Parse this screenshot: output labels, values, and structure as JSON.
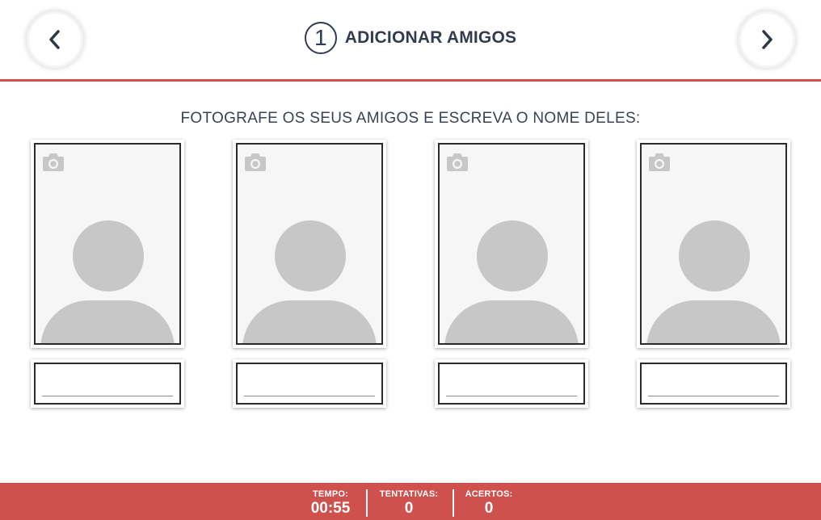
{
  "header": {
    "step_number": "1",
    "title": "ADICIONAR AMIGOS",
    "prev_icon": "chevron-left-icon",
    "next_icon": "chevron-right-icon"
  },
  "instruction": "FOTOGRAFE OS SEUS AMIGOS E ESCREVA O NOME DELES:",
  "friends": [
    {
      "photo_icon": "camera-icon",
      "name_value": ""
    },
    {
      "photo_icon": "camera-icon",
      "name_value": ""
    },
    {
      "photo_icon": "camera-icon",
      "name_value": ""
    },
    {
      "photo_icon": "camera-icon",
      "name_value": ""
    }
  ],
  "footer": {
    "time_label": "TEMPO:",
    "time_value": "00:55",
    "attempts_label": "TENTATIVAS:",
    "attempts_value": "0",
    "hits_label": "ACERTOS:",
    "hits_value": "0"
  },
  "colors": {
    "accent": "#cf514e",
    "text": "#323c4e",
    "placeholder": "#c7c7c7"
  }
}
